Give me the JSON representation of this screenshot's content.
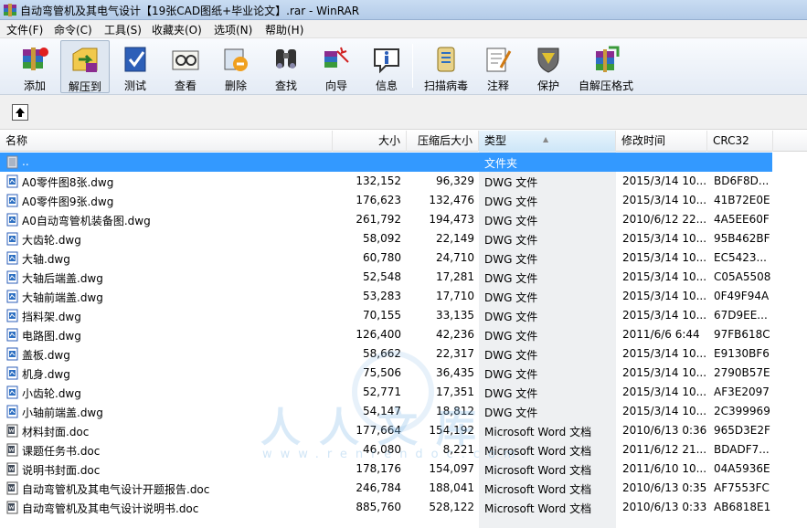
{
  "window": {
    "title": "自动弯管机及其电气设计【19张CAD图纸+毕业论文】.rar - WinRAR"
  },
  "menu": [
    {
      "label": "文件(F)"
    },
    {
      "label": "命令(C)"
    },
    {
      "label": "工具(S)"
    },
    {
      "label": "收藏夹(O)"
    },
    {
      "label": "选项(N)"
    },
    {
      "label": "帮助(H)"
    }
  ],
  "toolbar": [
    {
      "label": "添加",
      "icon": "add-archive-icon"
    },
    {
      "label": "解压到",
      "icon": "extract-to-icon"
    },
    {
      "label": "测试",
      "icon": "test-icon"
    },
    {
      "label": "查看",
      "icon": "view-icon"
    },
    {
      "label": "删除",
      "icon": "delete-icon"
    },
    {
      "label": "查找",
      "icon": "find-icon"
    },
    {
      "label": "向导",
      "icon": "wizard-icon"
    },
    {
      "label": "信息",
      "icon": "info-icon"
    },
    {
      "label": "扫描病毒",
      "icon": "virus-scan-icon"
    },
    {
      "label": "注释",
      "icon": "comment-icon"
    },
    {
      "label": "保护",
      "icon": "protect-icon"
    },
    {
      "label": "自解压格式",
      "icon": "sfx-icon"
    }
  ],
  "columns": {
    "name": "名称",
    "size": "大小",
    "packed": "压缩后大小",
    "type": "类型",
    "modified": "修改时间",
    "crc": "CRC32"
  },
  "files": [
    {
      "name": "..",
      "size": "",
      "packed": "",
      "type": "文件夹",
      "modified": "",
      "crc": "",
      "kind": "folder"
    },
    {
      "name": "A0零件图8张.dwg",
      "size": "132,152",
      "packed": "96,329",
      "type": "DWG 文件",
      "modified": "2015/3/14 10...",
      "crc": "BD6F8D...",
      "kind": "dwg"
    },
    {
      "name": "A0零件图9张.dwg",
      "size": "176,623",
      "packed": "132,476",
      "type": "DWG 文件",
      "modified": "2015/3/14 10...",
      "crc": "41B72E0E",
      "kind": "dwg"
    },
    {
      "name": "A0自动弯管机装备图.dwg",
      "size": "261,792",
      "packed": "194,473",
      "type": "DWG 文件",
      "modified": "2010/6/12 22...",
      "crc": "4A5EE60F",
      "kind": "dwg"
    },
    {
      "name": "大齿轮.dwg",
      "size": "58,092",
      "packed": "22,149",
      "type": "DWG 文件",
      "modified": "2015/3/14 10...",
      "crc": "95B462BF",
      "kind": "dwg"
    },
    {
      "name": "大轴.dwg",
      "size": "60,780",
      "packed": "24,710",
      "type": "DWG 文件",
      "modified": "2015/3/14 10...",
      "crc": "EC5423...",
      "kind": "dwg"
    },
    {
      "name": "大轴后端盖.dwg",
      "size": "52,548",
      "packed": "17,281",
      "type": "DWG 文件",
      "modified": "2015/3/14 10...",
      "crc": "C05A5508",
      "kind": "dwg"
    },
    {
      "name": "大轴前端盖.dwg",
      "size": "53,283",
      "packed": "17,710",
      "type": "DWG 文件",
      "modified": "2015/3/14 10...",
      "crc": "0F49F94A",
      "kind": "dwg"
    },
    {
      "name": "挡料架.dwg",
      "size": "70,155",
      "packed": "33,135",
      "type": "DWG 文件",
      "modified": "2015/3/14 10...",
      "crc": "67D9EE...",
      "kind": "dwg"
    },
    {
      "name": "电路图.dwg",
      "size": "126,400",
      "packed": "42,236",
      "type": "DWG 文件",
      "modified": "2011/6/6 6:44",
      "crc": "97FB618C",
      "kind": "dwg"
    },
    {
      "name": "盖板.dwg",
      "size": "58,662",
      "packed": "22,317",
      "type": "DWG 文件",
      "modified": "2015/3/14 10...",
      "crc": "E9130BF6",
      "kind": "dwg"
    },
    {
      "name": "机身.dwg",
      "size": "75,506",
      "packed": "36,435",
      "type": "DWG 文件",
      "modified": "2015/3/14 10...",
      "crc": "2790B57E",
      "kind": "dwg"
    },
    {
      "name": "小齿轮.dwg",
      "size": "52,771",
      "packed": "17,351",
      "type": "DWG 文件",
      "modified": "2015/3/14 10...",
      "crc": "AF3E2097",
      "kind": "dwg"
    },
    {
      "name": "小轴前端盖.dwg",
      "size": "54,147",
      "packed": "18,812",
      "type": "DWG 文件",
      "modified": "2015/3/14 10...",
      "crc": "2C399969",
      "kind": "dwg"
    },
    {
      "name": "材料封面.doc",
      "size": "177,664",
      "packed": "154,192",
      "type": "Microsoft Word 文档",
      "modified": "2010/6/13 0:36",
      "crc": "965D3E2F",
      "kind": "doc"
    },
    {
      "name": "课题任务书.doc",
      "size": "46,080",
      "packed": "8,221",
      "type": "Microsoft Word 文档",
      "modified": "2011/6/12 21...",
      "crc": "BDADF7...",
      "kind": "doc"
    },
    {
      "name": "说明书封面.doc",
      "size": "178,176",
      "packed": "154,097",
      "type": "Microsoft Word 文档",
      "modified": "2011/6/10 10...",
      "crc": "04A5936E",
      "kind": "doc"
    },
    {
      "name": "自动弯管机及其电气设计开题报告.doc",
      "size": "246,784",
      "packed": "188,041",
      "type": "Microsoft Word 文档",
      "modified": "2010/6/13 0:35",
      "crc": "AF7553FC",
      "kind": "doc"
    },
    {
      "name": "自动弯管机及其电气设计说明书.doc",
      "size": "885,760",
      "packed": "528,122",
      "type": "Microsoft Word 文档",
      "modified": "2010/6/13 0:33",
      "crc": "AB6818E1",
      "kind": "doc"
    }
  ],
  "watermark": {
    "text": "人人文库",
    "url": "www.renrendoc.com"
  }
}
